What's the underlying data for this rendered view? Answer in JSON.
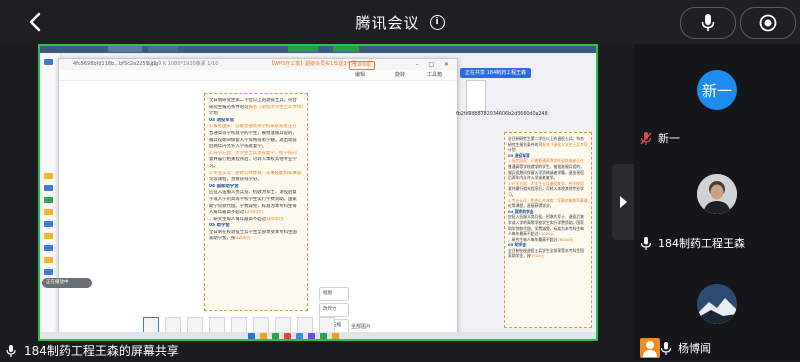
{
  "header": {
    "title": "腾讯会议"
  },
  "share_label": "184制药工程王森的屏幕共享",
  "shared_screen": {
    "viewer": {
      "file_name": "4fc5698bfd118b...bf5c2a2259.jpg",
      "meta": "525.9 K  1080*1920像素  1/10",
      "promo": "【WPS开工季】超级会员买1年送3个月",
      "cta": "立即领取",
      "tools": [
        "编辑",
        "旋转",
        "工具箱"
      ],
      "side_actions": [
        "抠图",
        "改尺寸",
        "图片压缩"
      ],
      "thumbs_label": "全部图片",
      "doc_lines": [
        {
          "text": "全日制研究生第二学位以上的退役士兵，符合"
        },
        {
          "text": "研究生报名条件的可",
          "hl": "报名《退役大学生士兵专项》"
        },
        {
          "text": "计划"
        },
        {
          "text": "03 退役军官",
          "head": true
        },
        {
          "text": "",
          "hl": "1.报考国家：已被普通高等学校录取或者正在"
        },
        {
          "text": "普通高等学校就学的学生，被批准服兵役的，"
        },
        {
          "text": "服兵役期间保留入学资格或者学籍，退出现役"
        },
        {
          "text": "后两年内允许入学或者复学。"
        },
        {
          "text": "",
          "hl": "2.升学方面：大学生士兵退役复学，经学校同"
        },
        {
          "text": "意并履行相关程序后，可转入本校其他专业学"
        },
        {
          "text": "习。"
        },
        {
          "text": "",
          "hl": "3.专业认可：免修公共体育、军事技能和军事理"
        },
        {
          "text": "论等课程，直接获得学分。"
        },
        {
          "text": "04 国家助学金",
          "head": true
        },
        {
          "text": "应征入伍服义务兵役、招收为军士、退役后复"
        },
        {
          "text": "学或入学的高等学校学生实行学费资助。国家"
        },
        {
          "text": "助学贷款代偿。学费减免，标准为本专科生每"
        },
        {
          "text": "人每年最高不超过",
          "hl": "12000元"
        },
        {
          "text": "，研究生每人每年最高不超过",
          "hl": "16000元"
        },
        {
          "text": "05 助学金",
          "head": true
        },
        {
          "text": "全日制在校退役士兵学生全部享受本专科生国"
        },
        {
          "text": "家助学金，按",
          "hl": "3300元"
        }
      ]
    },
    "right": {
      "share_tag": "正在共享  184制药工程王森",
      "file_caption": "fb2fe9db8782034606b2d3660d0a248",
      "chat_bubble": "正在播放中"
    }
  },
  "participants": [
    {
      "name": "新一",
      "avatar_text": "新一",
      "muted": true
    },
    {
      "name": "184制药工程王森",
      "muted": false
    },
    {
      "name": "杨博闻",
      "muted": false
    }
  ]
}
